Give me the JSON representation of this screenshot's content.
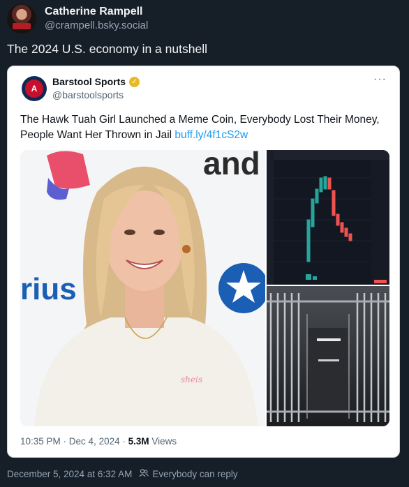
{
  "post": {
    "author_name": "Catherine Rampell",
    "author_handle": "@crampell.bsky.social",
    "text": "The 2024 U.S. economy in a nutshell",
    "timestamp": "December 5, 2024 at 6:32 AM",
    "reply_setting": "Everybody can reply"
  },
  "embed": {
    "author_name": "Barstool Sports",
    "author_handle": "@barstoolsports",
    "text": "The Hawk Tuah Girl Launched a Meme Coin, Everybody Lost Their Money, People Want Her Thrown in Jail",
    "link": "buff.ly/4f1cS2w",
    "time": "10:35 PM",
    "date": "Dec 4, 2024",
    "views_count": "5.3M",
    "views_label": "Views",
    "more_label": "···",
    "photo_text_left": "rius",
    "photo_text_top": "and",
    "shirt_text": "sheis"
  },
  "colors": {
    "background": "#161e27",
    "link": "#1d9bf0",
    "candle_up": "#26a69a",
    "candle_down": "#ef5350"
  }
}
